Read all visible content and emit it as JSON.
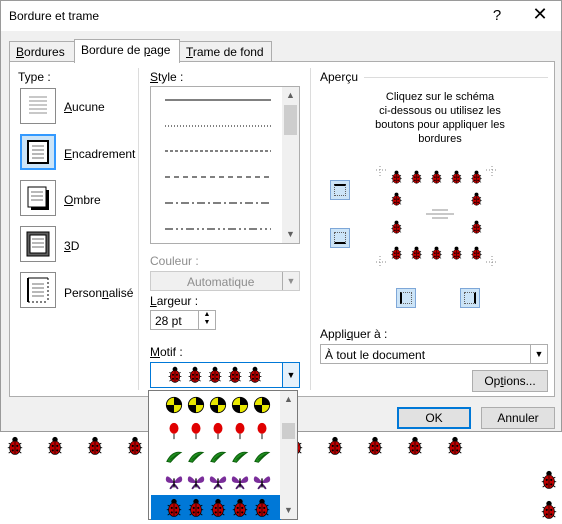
{
  "title": "Bordure et trame",
  "help_label": "?",
  "close_label": "✕",
  "tabs": [
    {
      "label": "Bordures",
      "accel": "B",
      "rest": "ordures"
    },
    {
      "label": "Bordure de page",
      "pre": "Bordure de ",
      "accel": "p",
      "rest": "age"
    },
    {
      "label": "Trame de fond",
      "accel": "T",
      "rest": "rame de fond"
    }
  ],
  "type": {
    "label": "Type :",
    "items": [
      {
        "pre": "",
        "accel": "A",
        "rest": "ucune",
        "icon": "none-border-icon"
      },
      {
        "pre": "",
        "accel": "E",
        "rest": "ncadrement",
        "icon": "box-border-icon"
      },
      {
        "pre": "",
        "accel": "O",
        "rest": "mbre",
        "icon": "shadow-border-icon"
      },
      {
        "pre": "",
        "accel": "3",
        "rest": "D",
        "icon": "3d-border-icon"
      },
      {
        "pre": "Person",
        "accel": "n",
        "rest": "alisé",
        "icon": "custom-border-icon"
      }
    ]
  },
  "style": {
    "label_accel": "S",
    "label_rest": "tyle :"
  },
  "couleur": {
    "label": "Couleur :",
    "value": "Automatique"
  },
  "largeur": {
    "label_accel": "L",
    "label_rest": "argeur :",
    "value": "28 pt"
  },
  "motif": {
    "label_accel": "M",
    "label_rest": "otif :"
  },
  "apercu": {
    "label": "Aperçu",
    "instructions": [
      "Cliquez sur le schéma",
      "ci-dessous ou utilisez les",
      "boutons pour appliquer les",
      "bordures"
    ]
  },
  "appliquer": {
    "label_pre": "Appli",
    "label_accel": "q",
    "label_rest": "uer à :",
    "value": "À tout le document"
  },
  "buttons": {
    "options_pre": "Op",
    "options_accel": "t",
    "options_rest": "ions...",
    "ok": "OK",
    "annuler": "Annuler"
  },
  "colors": {
    "accent": "#0078d7",
    "bug_red": "#c00000",
    "selection": "#cce4f7"
  }
}
